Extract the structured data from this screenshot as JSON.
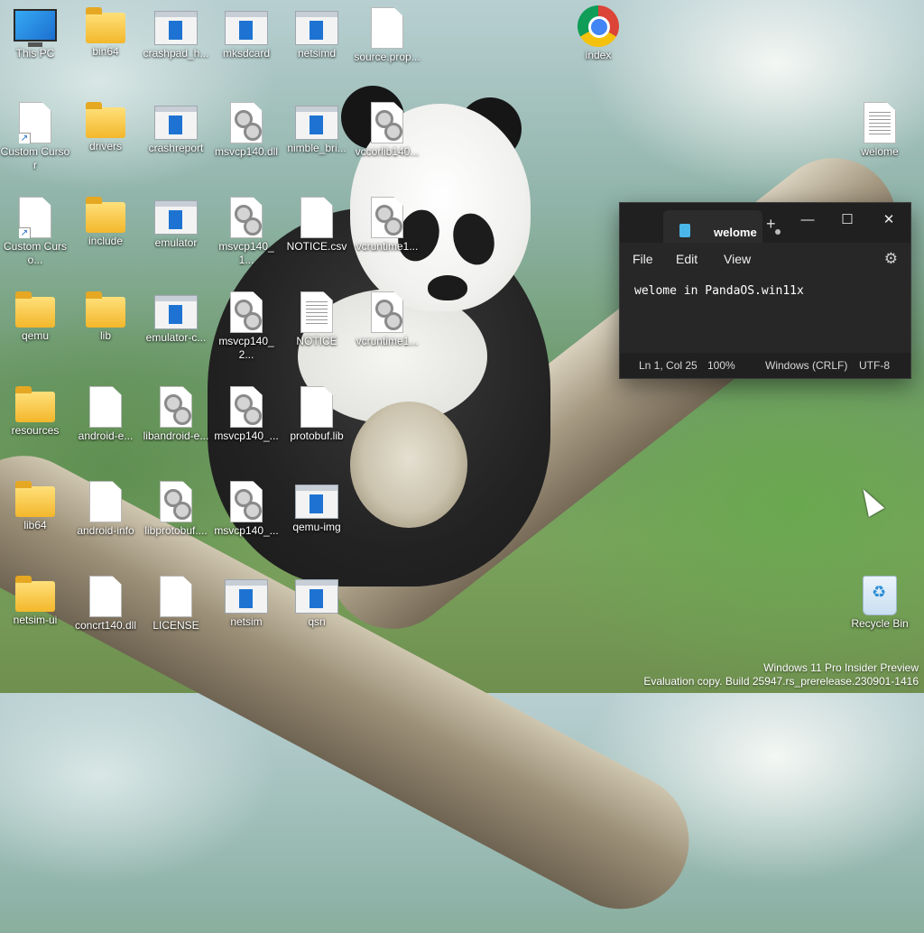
{
  "desktop": {
    "icons": [
      {
        "label": "This PC",
        "type": "monitor"
      },
      {
        "label": "bin64",
        "type": "folder"
      },
      {
        "label": "crashpad_h...",
        "type": "app"
      },
      {
        "label": "mksdcard",
        "type": "app"
      },
      {
        "label": "netsimd",
        "type": "app"
      },
      {
        "label": "source.prop...",
        "type": "doc"
      },
      {
        "label": "index",
        "type": "chrome"
      },
      {
        "label": "Custom Cursor",
        "type": "doc-shortcut"
      },
      {
        "label": "drivers",
        "type": "folder"
      },
      {
        "label": "crashreport",
        "type": "app"
      },
      {
        "label": "msvcp140.dll",
        "type": "cog"
      },
      {
        "label": "nimble_bri...",
        "type": "app"
      },
      {
        "label": "vccorlib140...",
        "type": "cog"
      },
      {
        "label": "welome",
        "type": "doc-lines"
      },
      {
        "label": "Custom Curso...",
        "type": "doc-shortcut"
      },
      {
        "label": "include",
        "type": "folder"
      },
      {
        "label": "emulator",
        "type": "app"
      },
      {
        "label": "msvcp140_1...",
        "type": "cog"
      },
      {
        "label": "NOTICE.csv",
        "type": "doc"
      },
      {
        "label": "vcruntime1...",
        "type": "cog"
      },
      {
        "label": "qemu",
        "type": "folder"
      },
      {
        "label": "lib",
        "type": "folder"
      },
      {
        "label": "emulator-c...",
        "type": "app"
      },
      {
        "label": "msvcp140_2...",
        "type": "cog"
      },
      {
        "label": "NOTICE",
        "type": "doc-lines"
      },
      {
        "label": "vcruntime1...",
        "type": "cog"
      },
      {
        "label": "resources",
        "type": "folder"
      },
      {
        "label": "android-e...",
        "type": "doc"
      },
      {
        "label": "libandroid-e...",
        "type": "cog"
      },
      {
        "label": "msvcp140_...",
        "type": "cog"
      },
      {
        "label": "protobuf.lib",
        "type": "doc"
      },
      {
        "label": "lib64",
        "type": "folder"
      },
      {
        "label": "android-info",
        "type": "doc"
      },
      {
        "label": "libprotobuf....",
        "type": "cog"
      },
      {
        "label": "msvcp140_...",
        "type": "cog"
      },
      {
        "label": "qemu-img",
        "type": "app"
      },
      {
        "label": "netsim-ui",
        "type": "folder"
      },
      {
        "label": "concrt140.dll",
        "type": "doc"
      },
      {
        "label": "LICENSE",
        "type": "doc"
      },
      {
        "label": "netsim",
        "type": "app"
      },
      {
        "label": "qsn",
        "type": "app"
      },
      {
        "label": "Recycle Bin",
        "type": "bin"
      }
    ]
  },
  "notepad": {
    "tab_title": "welome",
    "new_tab": "+",
    "minimize": "—",
    "maximize": "☐",
    "close": "✕",
    "menu": {
      "file": "File",
      "edit": "Edit",
      "view": "View"
    },
    "settings_icon": "⚙",
    "content": "welome in PandaOS.win11x",
    "status": {
      "position": "Ln 1, Col 25",
      "zoom": "100%",
      "line_ending": "Windows (CRLF)",
      "encoding": "UTF-8"
    }
  },
  "watermark": {
    "line1": "Windows 11 Pro Insider Preview",
    "line2": "Evaluation copy. Build 25947.rs_prerelease.230901-1416"
  }
}
